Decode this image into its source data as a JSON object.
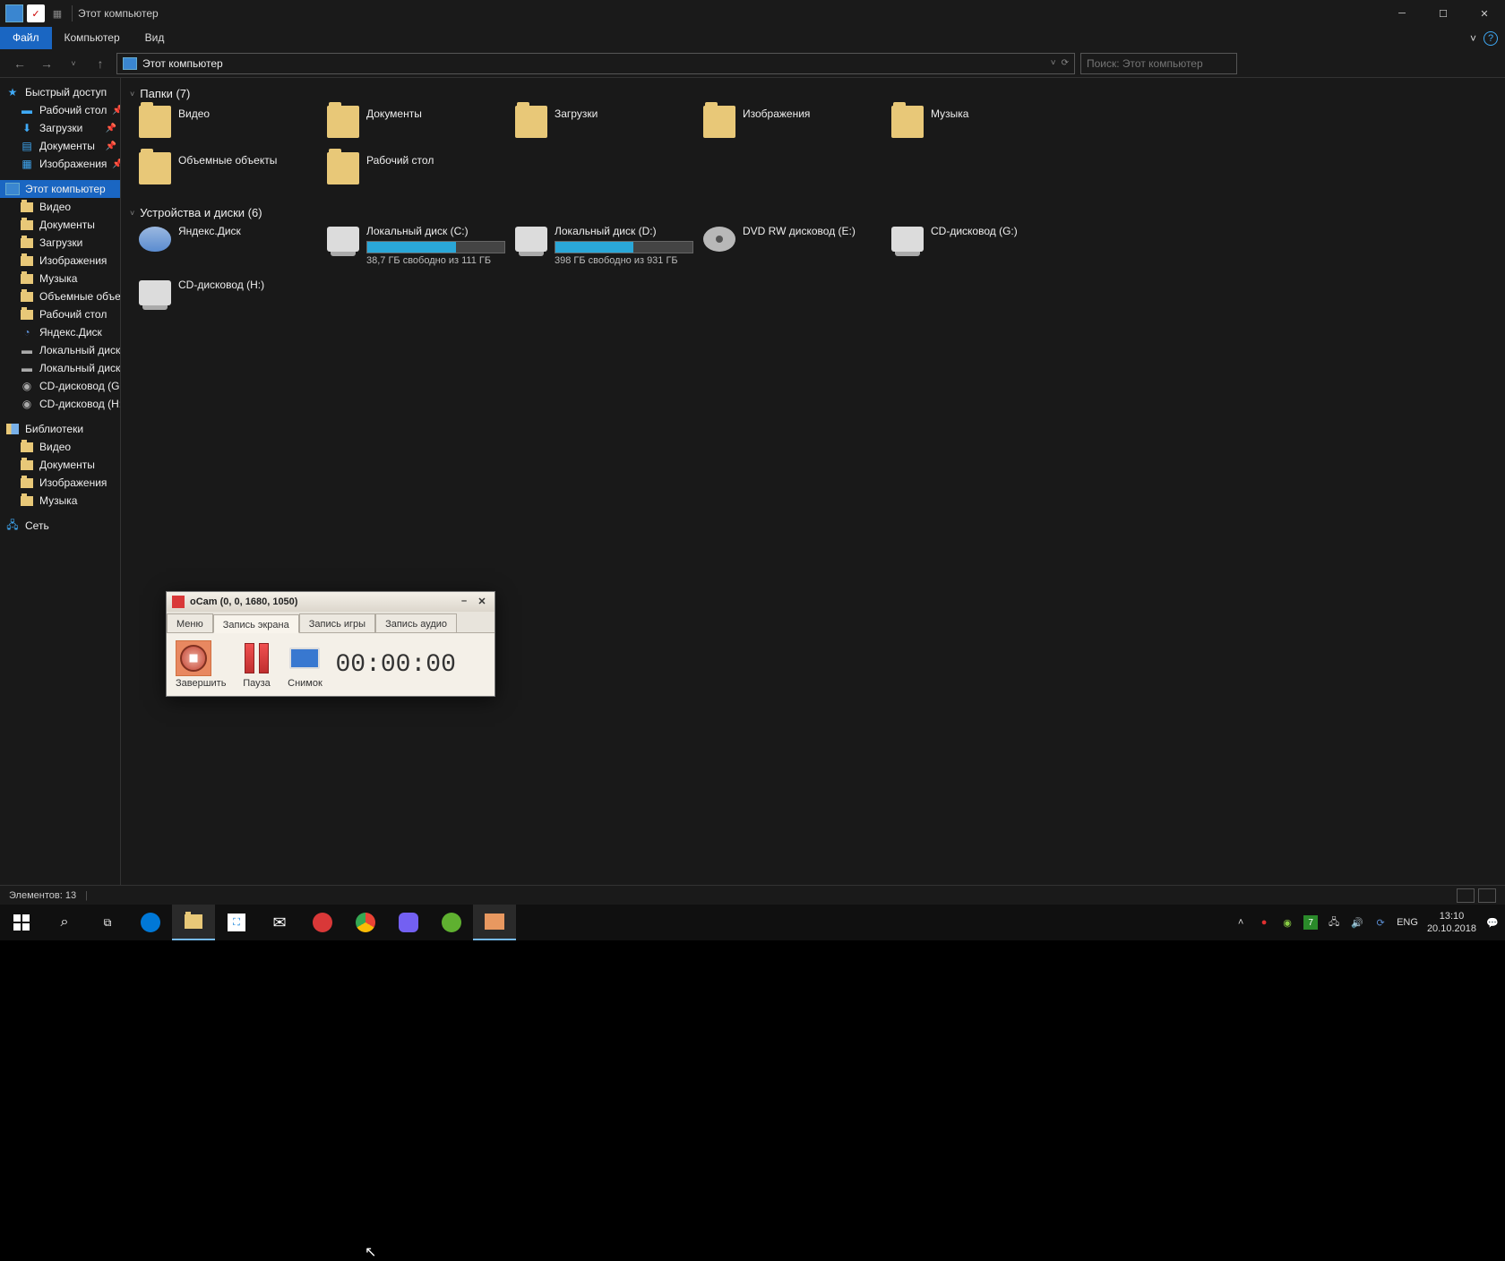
{
  "titlebar": {
    "title": "Этот компьютер"
  },
  "ribbon": {
    "file": "Файл",
    "computer": "Компьютер",
    "view": "Вид"
  },
  "address": {
    "path": "Этот компьютер"
  },
  "search": {
    "placeholder": "Поиск: Этот компьютер"
  },
  "sidebar": {
    "quick": "Быстрый доступ",
    "quick_items": [
      {
        "label": "Рабочий стол",
        "pin": true
      },
      {
        "label": "Загрузки",
        "pin": true
      },
      {
        "label": "Документы",
        "pin": true
      },
      {
        "label": "Изображения",
        "pin": true
      }
    ],
    "thispc": "Этот компьютер",
    "pc_items": [
      "Видео",
      "Документы",
      "Загрузки",
      "Изображения",
      "Музыка",
      "Объемные объекты",
      "Рабочий стол",
      "Яндекс.Диск",
      "Локальный диск (C:)",
      "Локальный диск (D:)",
      "CD-дисковод (G:)",
      "CD-дисковод (H:)"
    ],
    "libraries": "Библиотеки",
    "lib_items": [
      "Видео",
      "Документы",
      "Изображения",
      "Музыка"
    ],
    "network": "Сеть"
  },
  "groups": {
    "folders_title": "Папки (7)",
    "folders": [
      "Видео",
      "Документы",
      "Загрузки",
      "Изображения",
      "Музыка",
      "Объемные объекты",
      "Рабочий стол"
    ],
    "devices_title": "Устройства и диски (6)",
    "devices": [
      {
        "name": "Яндекс.Диск",
        "type": "cloud"
      },
      {
        "name": "Локальный диск (C:)",
        "type": "drive",
        "free": "38,7 ГБ свободно из 111 ГБ",
        "fill": 65
      },
      {
        "name": "Локальный диск (D:)",
        "type": "drive",
        "free": "398 ГБ свободно из 931 ГБ",
        "fill": 57
      },
      {
        "name": "DVD RW дисковод (E:)",
        "type": "dvd"
      },
      {
        "name": "CD-дисковод (G:)",
        "type": "cd"
      },
      {
        "name": "CD-дисковод (H:)",
        "type": "cd"
      }
    ]
  },
  "statusbar": {
    "count": "Элементов: 13"
  },
  "ocam": {
    "title": "oCam (0, 0, 1680, 1050)",
    "tabs": {
      "menu": "Меню",
      "screen": "Запись экрана",
      "game": "Запись игры",
      "audio": "Запись аудио"
    },
    "buttons": {
      "stop": "Завершить",
      "pause": "Пауза",
      "snap": "Снимок"
    },
    "timer": "00:00:00"
  },
  "tray": {
    "lang": "ENG",
    "time": "13:10",
    "date": "20.10.2018"
  }
}
